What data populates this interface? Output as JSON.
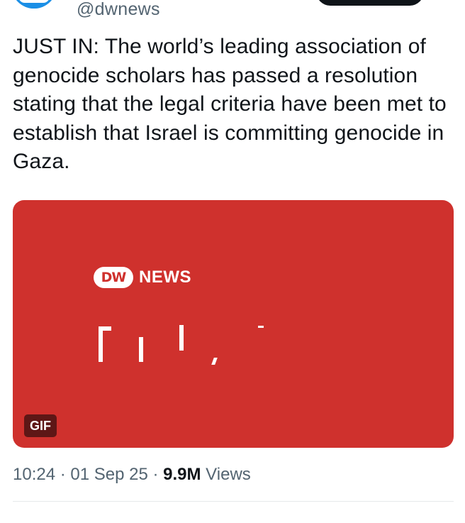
{
  "author": {
    "handle": "@dwnews"
  },
  "tweet": {
    "text": "JUST IN: The world’s leading association of genocide scholars has passed a resolution stating that the legal criteria have been met to establish that Israel is committing genocide in Gaza."
  },
  "media": {
    "logo_badge": "DW",
    "logo_text": "NEWS",
    "badge": "GIF",
    "background_color": "#cf312d"
  },
  "meta": {
    "time": "10:24",
    "separator1": " · ",
    "date": "01 Sep 25",
    "separator2": " · ",
    "views_count": "9.9M",
    "views_label": " Views"
  },
  "icons": {
    "avatar": "dw-logo-avatar",
    "follow": "follow-button"
  }
}
